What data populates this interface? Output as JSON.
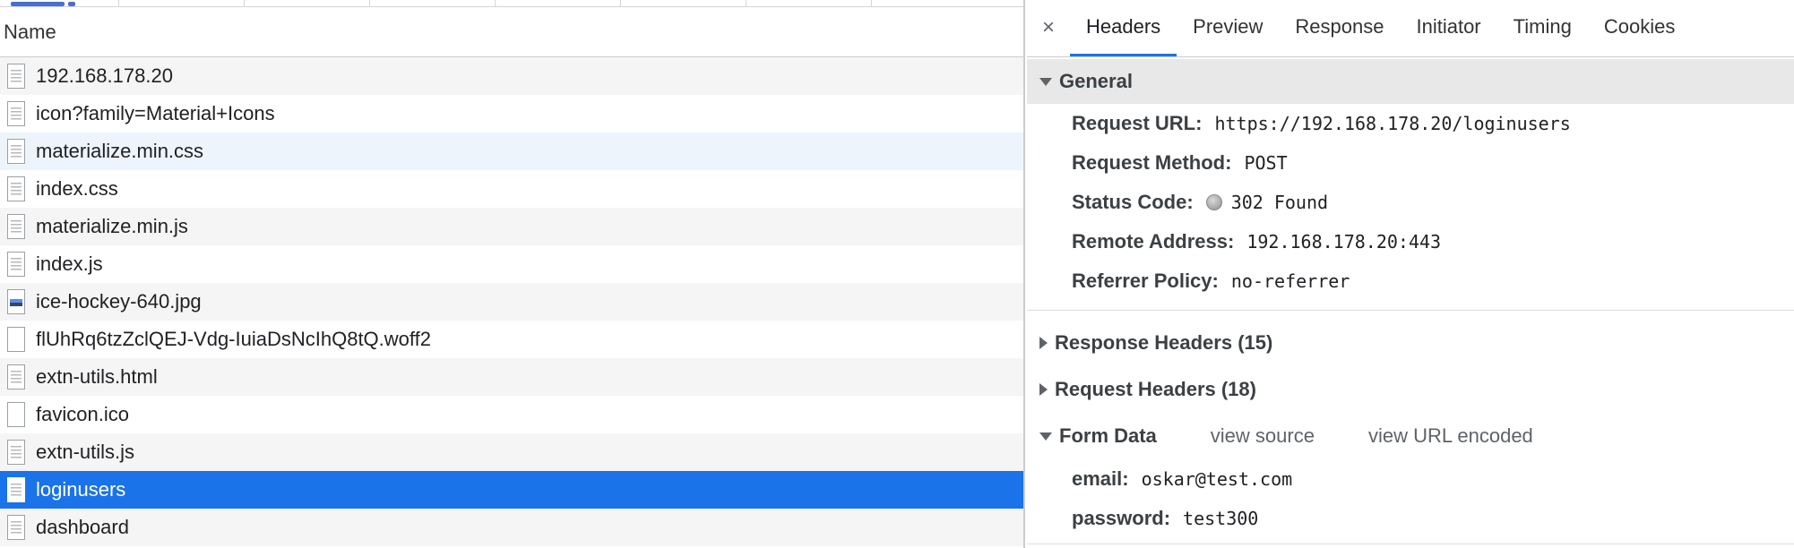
{
  "request_list": {
    "column_header": "Name",
    "rows": [
      {
        "name": "192.168.178.20",
        "icon": "document-icon"
      },
      {
        "name": "icon?family=Material+Icons",
        "icon": "document-icon"
      },
      {
        "name": "materialize.min.css",
        "icon": "document-icon"
      },
      {
        "name": "index.css",
        "icon": "document-icon"
      },
      {
        "name": "materialize.min.js",
        "icon": "document-icon"
      },
      {
        "name": "index.js",
        "icon": "document-icon"
      },
      {
        "name": "ice-hockey-640.jpg",
        "icon": "image-icon"
      },
      {
        "name": "flUhRq6tzZclQEJ-Vdg-IuiaDsNcIhQ8tQ.woff2",
        "icon": "blank-file-icon"
      },
      {
        "name": "extn-utils.html",
        "icon": "document-icon"
      },
      {
        "name": "favicon.ico",
        "icon": "blank-file-icon"
      },
      {
        "name": "extn-utils.js",
        "icon": "document-icon"
      },
      {
        "name": "loginusers",
        "icon": "document-icon",
        "selected": true
      },
      {
        "name": "dashboard",
        "icon": "document-icon"
      }
    ]
  },
  "details": {
    "close_symbol": "×",
    "tabs": [
      "Headers",
      "Preview",
      "Response",
      "Initiator",
      "Timing",
      "Cookies"
    ],
    "active_tab": "Headers",
    "general": {
      "title": "General",
      "fields": [
        {
          "key": "Request URL:",
          "value": "https://192.168.178.20/loginusers"
        },
        {
          "key": "Request Method:",
          "value": "POST"
        },
        {
          "key": "Status Code:",
          "value": "302 Found"
        },
        {
          "key": "Remote Address:",
          "value": "192.168.178.20:443"
        },
        {
          "key": "Referrer Policy:",
          "value": "no-referrer"
        }
      ]
    },
    "response_headers": "Response Headers (15)",
    "request_headers": "Request Headers (18)",
    "form_data": {
      "title": "Form Data",
      "view_source": "view source",
      "view_url_encoded": "view URL encoded",
      "fields": [
        {
          "key": "email:",
          "value": "oskar@test.com"
        },
        {
          "key": "password:",
          "value": "test300"
        }
      ]
    }
  },
  "colors": {
    "selected_row": "#1a73e8",
    "active_tab_underline": "#1a73e8",
    "general_header_bg": "#e8e8e8"
  }
}
